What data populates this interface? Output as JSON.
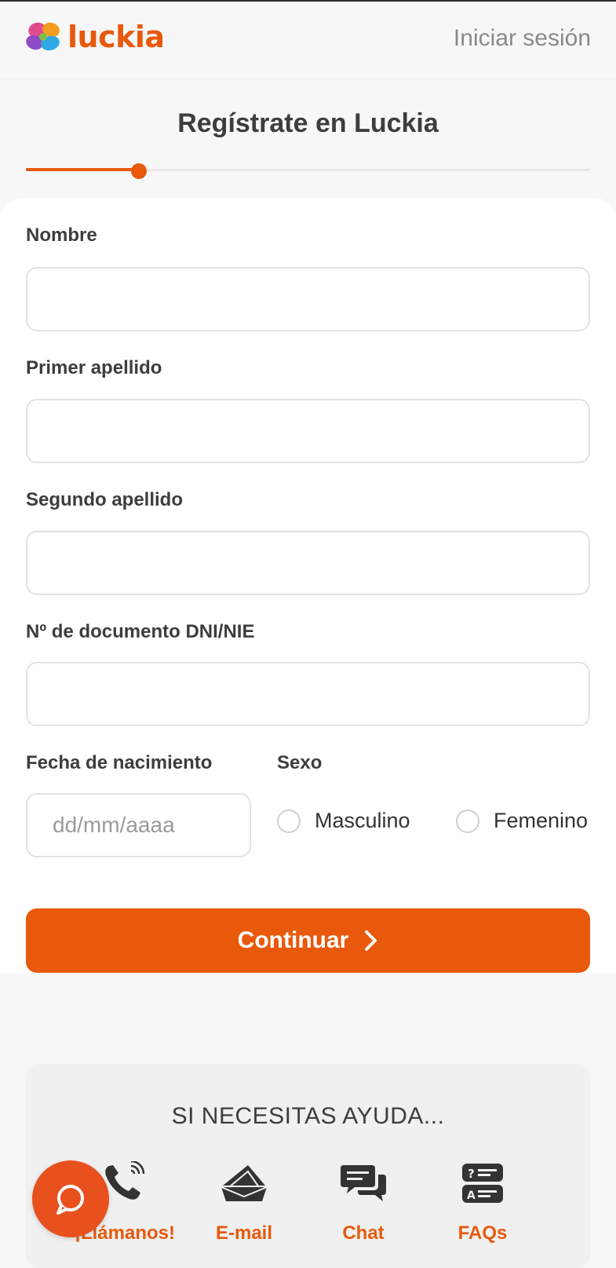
{
  "header": {
    "logo_text": "luckia",
    "login_label": "Iniciar sesión"
  },
  "page": {
    "title": "Regístrate en Luckia",
    "progress": 0.2
  },
  "form": {
    "nombre_label": "Nombre",
    "nombre_value": "",
    "primer_apellido_label": "Primer apellido",
    "primer_apellido_value": "",
    "segundo_apellido_label": "Segundo apellido",
    "segundo_apellido_value": "",
    "documento_label": "Nº de documento DNI/NIE",
    "documento_value": "",
    "fecha_label": "Fecha de nacimiento",
    "fecha_placeholder": "dd/mm/aaaa",
    "sexo_label": "Sexo",
    "sexo_options": [
      "Masculino",
      "Femenino"
    ],
    "continue_label": "Continuar"
  },
  "help": {
    "title": "SI NECESITAS AYUDA...",
    "items": [
      {
        "label": "¡Llámanos!",
        "icon": "phone-icon"
      },
      {
        "label": "E-mail",
        "icon": "envelope-icon"
      },
      {
        "label": "Chat",
        "icon": "chat-bubbles-icon"
      },
      {
        "label": "FAQs",
        "icon": "faq-icon"
      }
    ]
  },
  "colors": {
    "accent": "#e8590c",
    "fab": "#e8501e"
  }
}
